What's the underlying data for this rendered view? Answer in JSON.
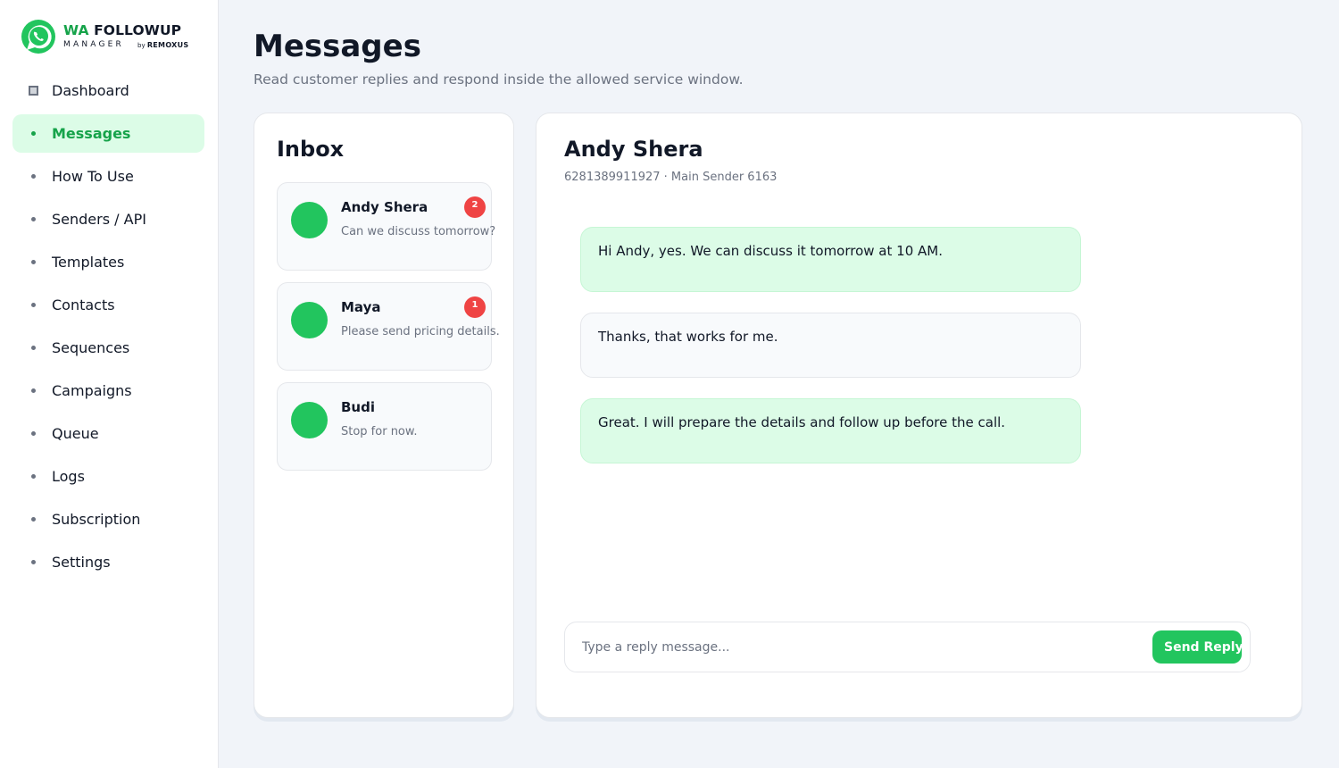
{
  "brand": {
    "title_accent": "WA",
    "title_rest": " FOLLOWUP",
    "subtitle": "MANAGER",
    "by_prefix": "by",
    "by_company": "REMOXUS",
    "logo_icon": "whatsapp-icon",
    "accent_color": "#22c55e"
  },
  "sidebar": {
    "items": [
      {
        "label": "Dashboard",
        "icon": "dashboard-icon",
        "active": false
      },
      {
        "label": "Messages",
        "icon": "bullet-icon",
        "active": true
      },
      {
        "label": "How To Use",
        "icon": "bullet-icon",
        "active": false
      },
      {
        "label": "Senders / API",
        "icon": "bullet-icon",
        "active": false
      },
      {
        "label": "Templates",
        "icon": "bullet-icon",
        "active": false
      },
      {
        "label": "Contacts",
        "icon": "bullet-icon",
        "active": false
      },
      {
        "label": "Sequences",
        "icon": "bullet-icon",
        "active": false
      },
      {
        "label": "Campaigns",
        "icon": "bullet-icon",
        "active": false
      },
      {
        "label": "Queue",
        "icon": "bullet-icon",
        "active": false
      },
      {
        "label": "Logs",
        "icon": "bullet-icon",
        "active": false
      },
      {
        "label": "Subscription",
        "icon": "bullet-icon",
        "active": false
      },
      {
        "label": "Settings",
        "icon": "bullet-icon",
        "active": false
      }
    ]
  },
  "header": {
    "title": "Messages",
    "subtitle": "Read customer replies and respond inside the allowed service window."
  },
  "inbox": {
    "title": "Inbox",
    "conversations": [
      {
        "name": "Andy Shera",
        "preview": "Can we discuss tomorrow?",
        "unread": "2"
      },
      {
        "name": "Maya",
        "preview": "Please send pricing details.",
        "unread": "1"
      },
      {
        "name": "Budi",
        "preview": "Stop for now.",
        "unread": ""
      }
    ]
  },
  "chat": {
    "contact_name": "Andy Shera",
    "meta": "6281389911927 · Main Sender 6163",
    "messages": [
      {
        "text": "Hi Andy, yes. We can discuss it tomorrow at 10 AM.",
        "direction": "outgoing"
      },
      {
        "text": "Thanks, that works for me.",
        "direction": "incoming"
      },
      {
        "text": "Great. I will prepare the details and follow up before the call.",
        "direction": "outgoing"
      }
    ],
    "reply_placeholder": "Type a reply message...",
    "reply_value": "",
    "send_label": "Send Reply"
  }
}
